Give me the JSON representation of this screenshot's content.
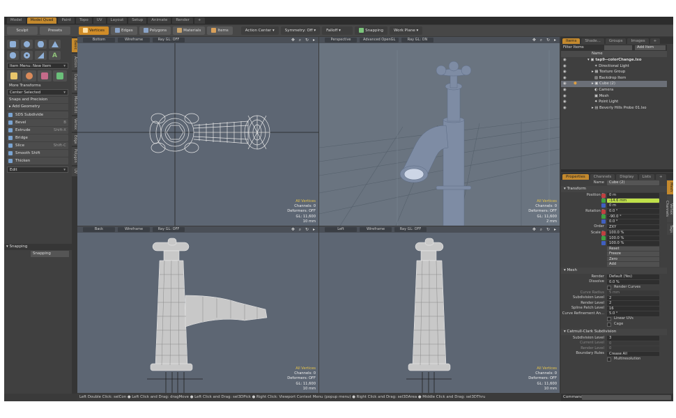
{
  "tabs": [
    "Model",
    "Model Quad",
    "Paint",
    "Topo",
    "UV",
    "Layout",
    "Setup",
    "Animate",
    "Render",
    "+"
  ],
  "active_tab": "Model Quad",
  "toolbar": {
    "sculpt": "Sculpt",
    "presets": "Presets",
    "vertices": "Vertices",
    "edges": "Edges",
    "polygons": "Polygons",
    "materials": "Materials",
    "items": "Items",
    "action_center": "Action Center",
    "symmetry": "Symmetry: Off",
    "falloff": "Falloff",
    "snapping": "Snapping",
    "work_plane": "Work Plane"
  },
  "left_panel": {
    "item_menu": "Item Menu: New Item",
    "more_transforms": "More Transforms",
    "center_selected": "Center Selected",
    "snaps_precision": "Snaps and Precision",
    "add_geometry": "Add Geometry",
    "tools": [
      {
        "label": "SDS Subdivide",
        "hotkey": ""
      },
      {
        "label": "Bevel",
        "hotkey": "B"
      },
      {
        "label": "Extrude",
        "hotkey": "Shift-X"
      },
      {
        "label": "Bridge",
        "hotkey": ""
      },
      {
        "label": "Slice",
        "hotkey": "Shift-C"
      },
      {
        "label": "Smooth Shift",
        "hotkey": ""
      },
      {
        "label": "Thicken",
        "hotkey": ""
      }
    ],
    "edit": "Edit",
    "snapping_section": "Snapping",
    "snapping_btn": "Snapping"
  },
  "vertical_tabs": [
    "Basic",
    "Action",
    "Duplicate",
    "Mesh Edit",
    "Vertex",
    "Edge",
    "Polygon",
    "UV"
  ],
  "viewports": [
    {
      "view": "Bottom",
      "mode": "Wireframe",
      "gl": "Ray GL: OFF",
      "stats": {
        "selection": "All Vertices",
        "channels": "Channels: 0",
        "deformers": "Deformers: OFF",
        "gl": "GL: 11,600",
        "scale": "10 mm"
      }
    },
    {
      "view": "Perspective",
      "mode": "Advanced OpenGL",
      "gl": "Ray GL: ON",
      "stats": {
        "selection": "All Vertices",
        "channels": "Channels: 0",
        "deformers": "Deformers: OFF",
        "gl": "GL: 11,600",
        "scale": "2 mm"
      }
    },
    {
      "view": "Back",
      "mode": "Wireframe",
      "gl": "Ray GL: OFF",
      "stats": {
        "selection": "All Vertices",
        "channels": "Channels: 0",
        "deformers": "Deformers: OFF",
        "gl": "GL: 11,600",
        "scale": "10 mm"
      }
    },
    {
      "view": "Left",
      "mode": "Wireframe",
      "gl": "Ray GL: OFF",
      "stats": {
        "selection": "All Vertices",
        "channels": "Channels: 0",
        "deformers": "Deformers: OFF",
        "gl": "GL: 11,600",
        "scale": "10 mm"
      }
    }
  ],
  "status_bar": "Left Double Click: selCon ● Left Click and Drag: dragMove ● Left Click and Drag: sel3DPick ● Right Click: Viewport Context Menu (popup menu) ● Right Click and Drag: sel3DArea ● Middle Click and Drag: sel3DThru",
  "items_panel": {
    "tabs": [
      "Items",
      "Shade...",
      "Groups",
      "Images",
      "+"
    ],
    "filter": "Filter Items",
    "add_item": "Add Item",
    "name_header": "Name",
    "items": [
      {
        "label": "tap9--colorChange.lxo",
        "depth": 0
      },
      {
        "label": "Directional Light",
        "depth": 1
      },
      {
        "label": "Texture Group",
        "depth": 1
      },
      {
        "label": "Backdrop Item",
        "depth": 1
      },
      {
        "label": "Cube (2)",
        "depth": 1,
        "selected": true
      },
      {
        "label": "Camera",
        "depth": 1
      },
      {
        "label": "Mesh",
        "depth": 1
      },
      {
        "label": "Point Light",
        "depth": 1
      },
      {
        "label": "Beverly Hills Probe 01.lxo",
        "depth": 1
      }
    ]
  },
  "properties": {
    "tabs": [
      "Properties",
      "Channels",
      "Display",
      "Lists",
      "+"
    ],
    "side_tabs": [
      "Mesh",
      "Vertex Channels",
      "Tags"
    ],
    "name_label": "Name",
    "name_value": "Cube (2)",
    "transform_header": "Transform",
    "position_label": "Position X",
    "position": [
      "0 m",
      "-14.6 mm",
      "0 m"
    ],
    "rotation_label": "Rotation X",
    "rotation": [
      "0.0 °",
      "-90.0 °",
      "0.0 °"
    ],
    "order_label": "Order",
    "order": "ZXY",
    "scale_label": "Scale X",
    "scale": [
      "100.0 %",
      "100.0 %",
      "100.0 %"
    ],
    "axis_y": "Y",
    "axis_z": "Z",
    "buttons": [
      "Reset",
      "Freeze",
      "Zero",
      "Add"
    ],
    "mesh_header": "Mesh",
    "render_label": "Render",
    "render": "Default (Yes)",
    "dissolve_label": "Dissolve",
    "dissolve": "0.0 %",
    "render_curves": "Render Curves",
    "curve_radius_label": "Curve Radius",
    "curve_radius": "5 mm",
    "subdiv_label": "Subdivision Level",
    "subdiv": "2",
    "render_level_label": "Render Level",
    "render_level": "2",
    "spline_label": "Spline Patch Level",
    "spline": "16",
    "curve_ref_label": "Curve Refinement An...",
    "curve_ref": "5.0 °",
    "linear_uvs": "Linear UVs",
    "cage": "Cage",
    "catmull_header": "Catmull-Clark Subdivision",
    "cc_subdiv_label": "Subdivision Level",
    "cc_subdiv": "3",
    "current_level_label": "Current Level",
    "current_level": "0",
    "cc_render_label": "Render Level",
    "cc_render": "0",
    "boundary_label": "Boundary Rules",
    "boundary": "Crease All",
    "multires": "Multiresolution"
  },
  "command_label": "Command"
}
